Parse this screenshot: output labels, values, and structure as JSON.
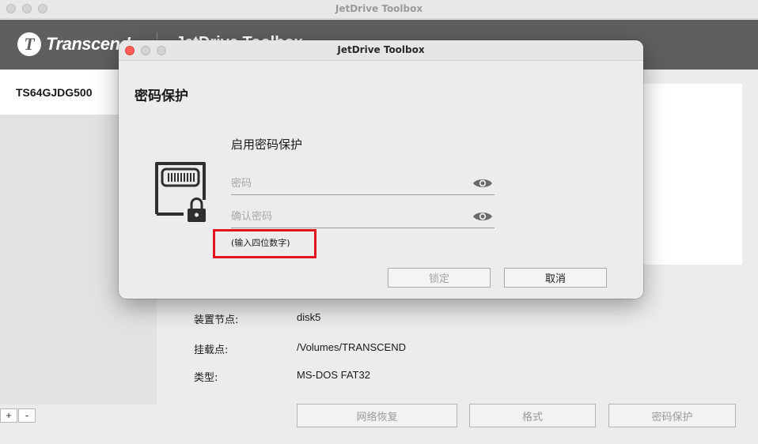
{
  "main_window": {
    "title": "JetDrive Toolbox",
    "brand_logo_letter": "T",
    "brand_name": "Transcend",
    "header_app_title": "JetDrive Toolbox",
    "sidebar": {
      "items": [
        {
          "label": "TS64GJDG500"
        }
      ]
    },
    "sidebar_buttons": {
      "add": "+",
      "remove": "-"
    },
    "info": [
      {
        "label": "装置节点:",
        "value": "disk5"
      },
      {
        "label": "挂载点:",
        "value": "/Volumes/TRANSCEND"
      },
      {
        "label": "类型:",
        "value": "MS-DOS FAT32"
      }
    ],
    "actions": {
      "network_restore": "网络恢复",
      "format": "格式",
      "password_protect": "密码保护"
    }
  },
  "dialog": {
    "title": "JetDrive Toolbox",
    "heading": "密码保护",
    "subheading": "启用密码保护",
    "password_placeholder": "密码",
    "confirm_placeholder": "确认密码",
    "hint": "(输入四位数字)",
    "lock_button": "锁定",
    "cancel_button": "取消",
    "icons": {
      "card": "memory-card-lock-icon",
      "eye": "eye-icon"
    },
    "colors": {
      "highlight": "#e3141e",
      "close": "#ff5f57"
    }
  }
}
